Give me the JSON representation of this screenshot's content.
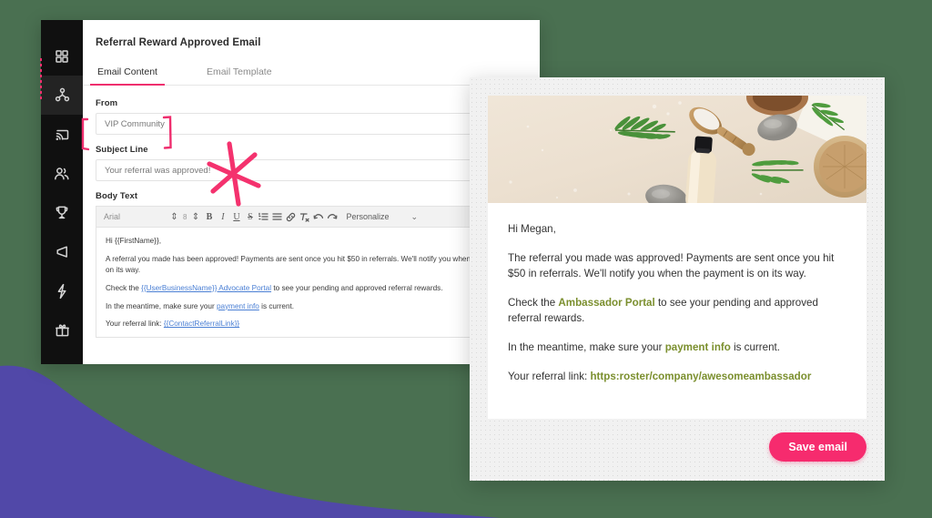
{
  "theme": {
    "background": "#4a7051",
    "blob": "#5148a8",
    "accent_pink": "#ef2e6e",
    "button_pink": "#f62b6e",
    "link_blue": "#4a7fd4",
    "preview_link_olive": "#7b8f2e",
    "sidebar_bg": "#101010"
  },
  "sidebar": {
    "items": [
      {
        "icon": "grid-dashboard-icon",
        "active": false
      },
      {
        "icon": "share-network-icon",
        "active": true
      },
      {
        "icon": "cast-screen-icon",
        "active": false
      },
      {
        "icon": "people-users-icon",
        "active": false
      },
      {
        "icon": "trophy-icon",
        "active": false
      },
      {
        "icon": "megaphone-icon",
        "active": false
      },
      {
        "icon": "lightning-bolt-icon",
        "active": false
      },
      {
        "icon": "gift-icon",
        "active": false
      }
    ]
  },
  "editor": {
    "title": "Referral Reward Approved Email",
    "tabs": [
      {
        "label": "Email Content",
        "active": true
      },
      {
        "label": "Email Template",
        "active": false
      }
    ],
    "fields": {
      "from_label": "From",
      "from_value": "VIP Community",
      "subject_label": "Subject Line",
      "subject_value": "Your referral was approved!",
      "body_label": "Body Text"
    },
    "toolbar": {
      "font": "Arial",
      "font_size": "8",
      "buttons": [
        "bold-icon",
        "italic-icon",
        "underline-icon",
        "strikethrough-icon",
        "ordered-list-icon",
        "unordered-list-icon",
        "link-icon",
        "clear-format-icon",
        "undo-icon",
        "redo-icon"
      ],
      "personalize_label": "Personalize",
      "caret": "chevron-down-icon"
    },
    "body_paragraphs": [
      {
        "parts": [
          {
            "t": "Hi {{FirstName}},"
          }
        ]
      },
      {
        "parts": [
          {
            "t": "A referral you made has been approved! Payments are sent once you hit $50 in referrals. We'll notify you when the payment is on its way."
          }
        ]
      },
      {
        "parts": [
          {
            "t": "Check the "
          },
          {
            "t": "{{UserBusinessName}} Advocate Portal",
            "link": true
          },
          {
            "t": " to see your pending and approved referral rewards."
          }
        ]
      },
      {
        "parts": [
          {
            "t": "In the meantime, make sure your "
          },
          {
            "t": "payment info",
            "link": true
          },
          {
            "t": " is current."
          }
        ]
      },
      {
        "parts": [
          {
            "t": "Your referral link: "
          },
          {
            "t": "{{ContactReferralLink}}",
            "link": true
          }
        ]
      }
    ]
  },
  "annotations": {
    "bracket_from_field": "pink-bracket-annotation",
    "star": "pink-star-annotation",
    "active_nav_dashes": "pink-dashed-marker"
  },
  "preview": {
    "hero_image_alt": "spa-flatlay-hero-image",
    "paragraphs": [
      {
        "parts": [
          {
            "t": "Hi Megan,"
          }
        ]
      },
      {
        "parts": [
          {
            "t": "The referral you made was approved! Payments are sent once you hit $50 in referrals. We'll notify you when the payment is on its way."
          }
        ]
      },
      {
        "parts": [
          {
            "t": "Check the "
          },
          {
            "t": "Ambassador Portal",
            "link": true
          },
          {
            "t": " to see your pending and approved referral rewards."
          }
        ]
      },
      {
        "parts": [
          {
            "t": "In the meantime, make sure your "
          },
          {
            "t": "payment info",
            "link": true
          },
          {
            "t": " is current."
          }
        ]
      },
      {
        "parts": [
          {
            "t": "Your referral link: "
          },
          {
            "t": "https:roster/company/awesomeambassador",
            "link": true
          }
        ]
      }
    ],
    "save_button_label": "Save email"
  }
}
